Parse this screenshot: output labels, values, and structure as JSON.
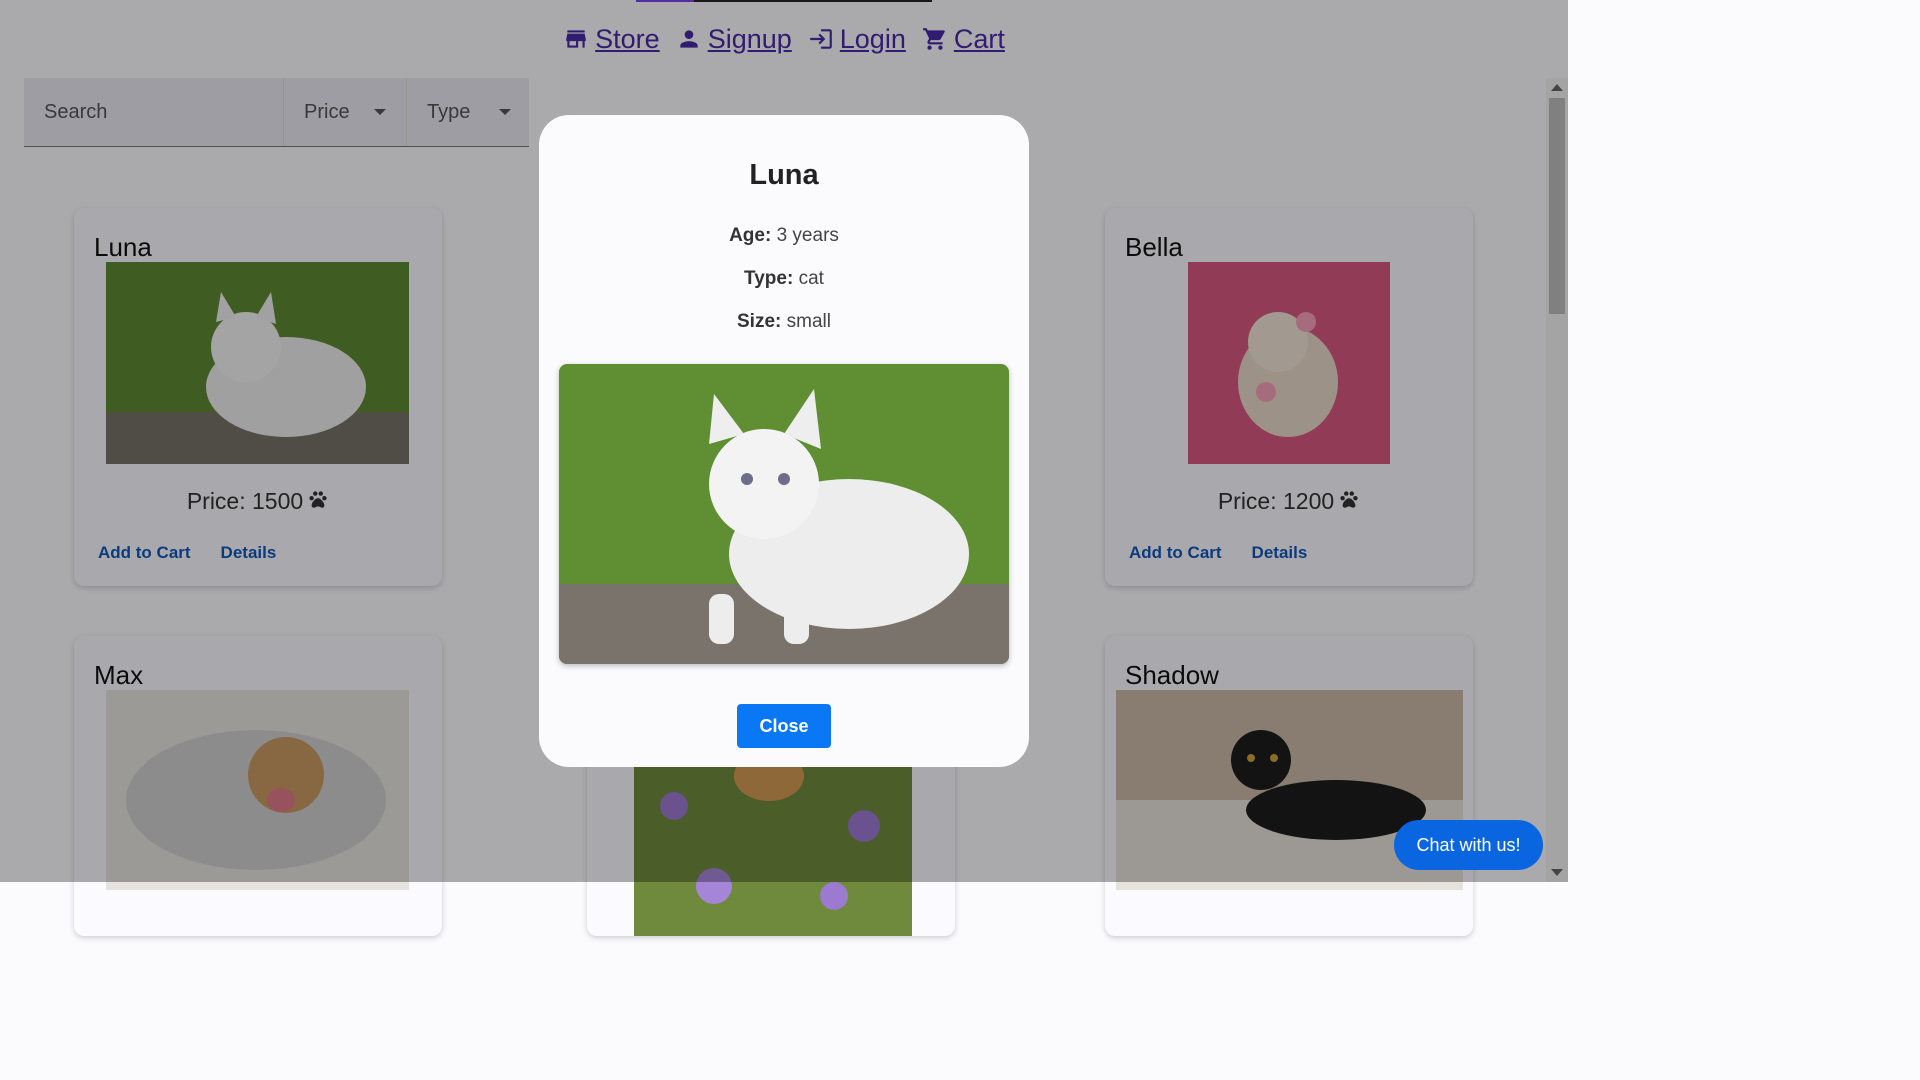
{
  "nav": {
    "links": [
      {
        "label": "Store",
        "icon": "store-icon"
      },
      {
        "label": "Signup",
        "icon": "person-icon"
      },
      {
        "label": "Login",
        "icon": "login-icon"
      },
      {
        "label": "Cart",
        "icon": "cart-icon"
      }
    ],
    "link_color": "#4b2aa8"
  },
  "filters": {
    "search_placeholder": "Search",
    "price_label": "Price",
    "type_label": "Type"
  },
  "pets": [
    {
      "name": "Luna",
      "price_text": "Price: 1500",
      "add_label": "Add to Cart",
      "details_label": "Details"
    },
    {
      "name": "Bella",
      "price_text": "Price: 1200",
      "add_label": "Add to Cart",
      "details_label": "Details"
    },
    {
      "name": "Max"
    },
    {
      "name": "Shadow"
    }
  ],
  "modal": {
    "title": "Luna",
    "age_label": "Age:",
    "age_value": " 3 years",
    "type_label": "Type:",
    "type_value": " cat",
    "size_label": "Size:",
    "size_value": " small",
    "close_label": "Close"
  },
  "chat": {
    "label": "Chat with us!"
  },
  "colors": {
    "accent": "#0a78f5",
    "link": "#1358b8",
    "chat": "#0a66e0"
  }
}
